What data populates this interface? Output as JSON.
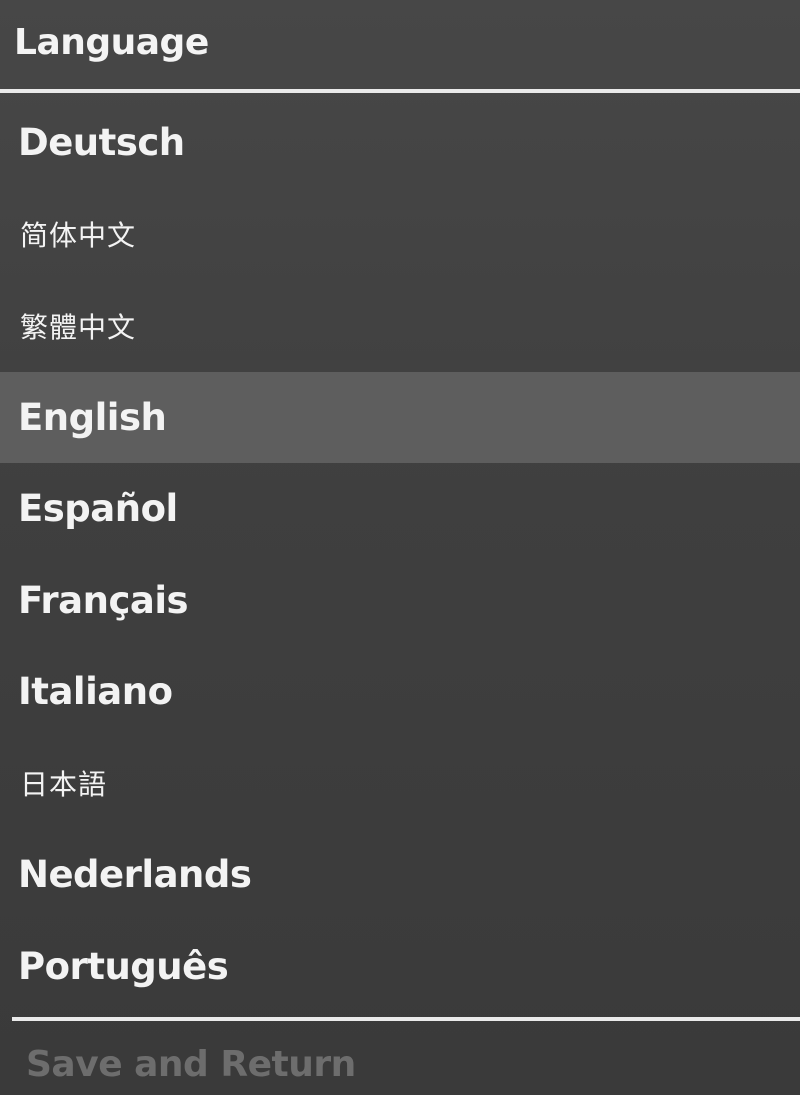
{
  "header": {
    "title": "Language"
  },
  "languages": [
    {
      "label": "Deutsch",
      "selected": false
    },
    {
      "label": "简体中文",
      "selected": false
    },
    {
      "label": "繁體中文",
      "selected": false
    },
    {
      "label": "English",
      "selected": true
    },
    {
      "label": "Español",
      "selected": false
    },
    {
      "label": "Français",
      "selected": false
    },
    {
      "label": "Italiano",
      "selected": false
    },
    {
      "label": "日本語",
      "selected": false
    },
    {
      "label": "Nederlands",
      "selected": false
    },
    {
      "label": "Português",
      "selected": false
    }
  ],
  "footer": {
    "action_label": "Save and Return",
    "action_enabled": false
  },
  "colors": {
    "background": "#3f3f3f",
    "highlight": "#5e5e5e",
    "text": "#f3f3f3",
    "disabled_text": "#6d6d6d",
    "divider": "#eaeaea"
  }
}
